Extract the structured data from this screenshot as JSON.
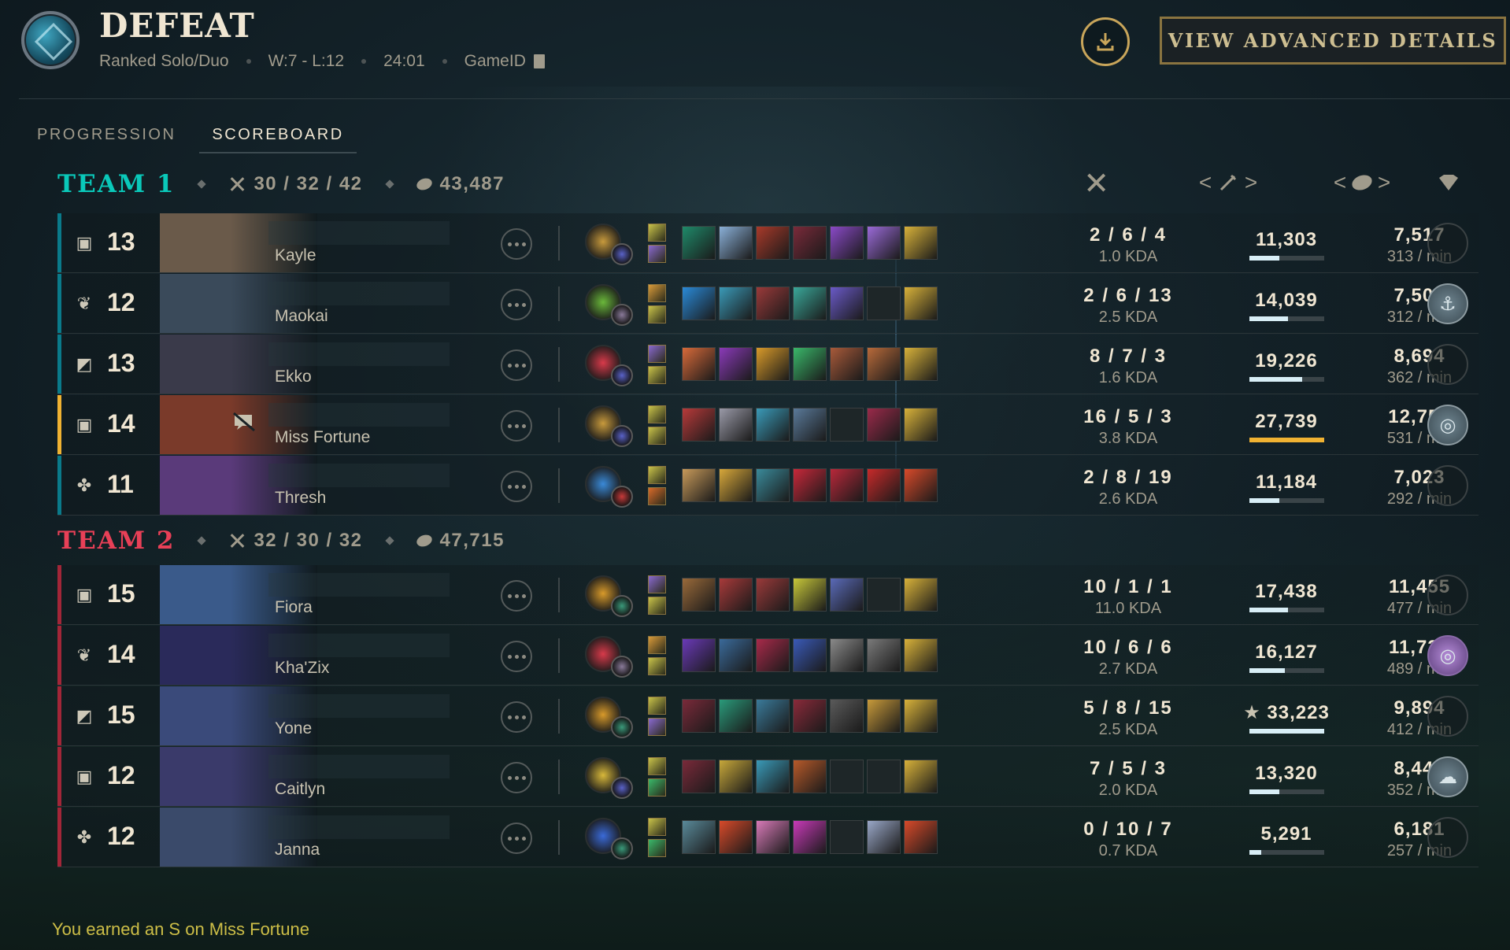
{
  "header": {
    "result": "DEFEAT",
    "queue": "Ranked Solo/Duo",
    "record": "W:7 - L:12",
    "duration": "24:01",
    "gameid_label": "GameID",
    "advanced_button": "VIEW ADVANCED DETAILS"
  },
  "tabs": [
    {
      "label": "PROGRESSION",
      "active": false
    },
    {
      "label": "SCOREBOARD",
      "active": true
    }
  ],
  "team1": {
    "name": "TEAM 1",
    "kda": "30 / 32 / 42",
    "gold": "43,487"
  },
  "team2": {
    "name": "TEAM 2",
    "kda": "32 / 30 / 32",
    "gold": "47,715"
  },
  "columns": {
    "sort_left": "<",
    "sort_right": ">"
  },
  "players_team1": [
    {
      "level": "13",
      "role": "top",
      "champion": "Kayle",
      "kda": "2 / 6 / 4",
      "kda_ratio": "1.0 KDA",
      "damage": "11,303",
      "damage_pct": 0.41,
      "gold": "7,517",
      "gpm": "313 / min",
      "badge": "none",
      "rune": "#c89a3c",
      "rune2": "#5a62c8",
      "spells": [
        "#c9c34a",
        "#8a6ad0"
      ],
      "items": [
        "#1f8a6a",
        "#8ab0d8",
        "#a83a2a",
        "#7a2a3a",
        "#8a4ac8",
        "#9a6ad8",
        "#d8b23a"
      ]
    },
    {
      "level": "12",
      "role": "jungle",
      "champion": "Maokai",
      "kda": "2 / 6 / 13",
      "kda_ratio": "2.5 KDA",
      "damage": "14,039",
      "damage_pct": 0.52,
      "gold": "7,503",
      "gpm": "312 / min",
      "badge": "anchor",
      "rune": "#6ab83a",
      "rune2": "#8a7a9a",
      "spells": [
        "#d89a3a",
        "#c9c34a"
      ],
      "items": [
        "#2a8ad8",
        "#3a9ab8",
        "#9a3a3a",
        "#3aa89a",
        "#6a5ac8",
        "",
        "#d8b23a"
      ]
    },
    {
      "level": "13",
      "role": "mid",
      "champion": "Ekko",
      "kda": "8 / 7 / 3",
      "kda_ratio": "1.6 KDA",
      "damage": "19,226",
      "damage_pct": 0.71,
      "gold": "8,694",
      "gpm": "362 / min",
      "badge": "none",
      "rune": "#d83a4a",
      "rune2": "#5a62c8",
      "spells": [
        "#8a6ad0",
        "#c9c34a"
      ],
      "items": [
        "#d86a3a",
        "#8a3ab8",
        "#d89a2a",
        "#3ab86a",
        "#a85a3a",
        "#b86a3a",
        "#d8b23a"
      ]
    },
    {
      "level": "14",
      "role": "bot",
      "champion": "Miss Fortune",
      "kda": "16 / 5 / 3",
      "kda_ratio": "3.8 KDA",
      "damage": "27,739",
      "damage_pct": 1.0,
      "gold": "12,750",
      "gpm": "531 / min",
      "badge": "coins",
      "rune": "#c89a3c",
      "rune2": "#5a62c8",
      "spells": [
        "#c9c34a",
        "#c9c34a"
      ],
      "items": [
        "#b83a3a",
        "#9a9aa8",
        "#3a9ab8",
        "#5a7a9a",
        "",
        "#9a2a4a",
        "#d8b23a"
      ],
      "is_me": true,
      "muted": true
    },
    {
      "level": "11",
      "role": "support",
      "champion": "Thresh",
      "kda": "2 / 8 / 19",
      "kda_ratio": "2.6 KDA",
      "damage": "11,184",
      "damage_pct": 0.41,
      "gold": "7,023",
      "gpm": "292 / min",
      "badge": "none",
      "rune": "#3a8ad8",
      "rune2": "#c83a3a",
      "spells": [
        "#c9c34a",
        "#d86a2a"
      ],
      "items": [
        "#c89a5a",
        "#d8a83a",
        "#3a8a9a",
        "#c8283a",
        "#b8283a",
        "#c82a2a",
        "#d84a2a"
      ]
    }
  ],
  "players_team2": [
    {
      "level": "15",
      "role": "top",
      "champion": "Fiora",
      "kda": "10 / 1 / 1",
      "kda_ratio": "11.0 KDA",
      "damage": "17,438",
      "damage_pct": 0.52,
      "gold": "11,455",
      "gpm": "477 / min",
      "badge": "none",
      "rune": "#d89a2a",
      "rune2": "#3a9a7a",
      "spells": [
        "#8a6ad0",
        "#c9c34a"
      ],
      "items": [
        "#9a6a3a",
        "#a83a3a",
        "#9a3a3a",
        "#c8c83a",
        "#5a6ab8",
        "",
        "#d8b23a"
      ]
    },
    {
      "level": "14",
      "role": "jungle",
      "champion": "Kha'Zix",
      "kda": "10 / 6 / 6",
      "kda_ratio": "2.7 KDA",
      "damage": "16,127",
      "damage_pct": 0.48,
      "gold": "11,739",
      "gpm": "489 / min",
      "badge": "purple",
      "rune": "#d83a4a",
      "rune2": "#8a7a9a",
      "spells": [
        "#d89a3a",
        "#c9c34a"
      ],
      "items": [
        "#6a3ab8",
        "#3a6a9a",
        "#a82a4a",
        "#3a5ab8",
        "#8a8a8a",
        "#7a7a7a",
        "#d8b23a"
      ]
    },
    {
      "level": "15",
      "role": "mid",
      "champion": "Yone",
      "kda": "5 / 8 / 15",
      "kda_ratio": "2.5 KDA",
      "damage": "33,223",
      "damage_pct": 1.0,
      "gold": "9,894",
      "gpm": "412 / min",
      "badge": "none",
      "rune": "#d89a2a",
      "rune2": "#3a9a7a",
      "spells": [
        "#c9c34a",
        "#8a6ad0"
      ],
      "items": [
        "#7a2a3a",
        "#2a9a7a",
        "#3a7a9a",
        "#8a2a3a",
        "#5a5a5a",
        "#c89a3a",
        "#d8b23a"
      ],
      "top_damage": true
    },
    {
      "level": "12",
      "role": "bot",
      "champion": "Caitlyn",
      "kda": "7 / 5 / 3",
      "kda_ratio": "2.0 KDA",
      "damage": "13,320",
      "damage_pct": 0.4,
      "gold": "8,446",
      "gpm": "352 / min",
      "badge": "ghost",
      "rune": "#d8b83a",
      "rune2": "#5a62c8",
      "spells": [
        "#c9c34a",
        "#3ab86a"
      ],
      "items": [
        "#7a2a3a",
        "#c8a83a",
        "#3a9ab8",
        "#b85a2a",
        "",
        "",
        "#d8b23a"
      ]
    },
    {
      "level": "12",
      "role": "support",
      "champion": "Janna",
      "kda": "0 / 10 / 7",
      "kda_ratio": "0.7 KDA",
      "damage": "5,291",
      "damage_pct": 0.16,
      "gold": "6,181",
      "gpm": "257 / min",
      "badge": "none",
      "rune": "#3a6ad8",
      "rune2": "#3a9a7a",
      "spells": [
        "#c9c34a",
        "#3ab86a"
      ],
      "items": [
        "#5a8a9a",
        "#d84a2a",
        "#d87ab8",
        "#c83ab8",
        "",
        "#9aa8c8",
        "#d84a2a"
      ]
    }
  ],
  "footer": {
    "earned": "You earned an S on Miss Fortune"
  }
}
